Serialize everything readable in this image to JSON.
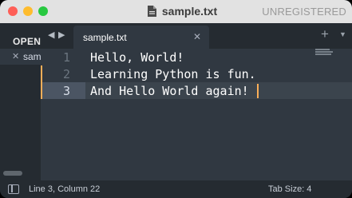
{
  "window": {
    "title": "sample.txt",
    "license_status": "UNREGISTERED"
  },
  "sidebar": {
    "header": "OPEN FILES",
    "files": [
      {
        "close_glyph": "✕",
        "label": "sample.txt"
      }
    ]
  },
  "tabbar": {
    "nav_back": "◀",
    "nav_forward": "▶",
    "tabs": [
      {
        "label": "sample.txt",
        "close_glyph": "✕"
      }
    ],
    "add_glyph": "+",
    "menu_glyph": "▼"
  },
  "editor": {
    "lines": [
      {
        "number": "1",
        "text": "Hello, World!"
      },
      {
        "number": "2",
        "text": "Learning Python is fun."
      },
      {
        "number": "3",
        "text": "And Hello World again!"
      }
    ],
    "active_line": 3
  },
  "statusbar": {
    "position": "Line 3, Column 22",
    "tab_size": "Tab Size: 4"
  },
  "colors": {
    "background": "#303841",
    "sidebar": "#252b31",
    "accent_caret": "#f9ae58",
    "close": "#fe5f57",
    "minimize": "#febc2e",
    "maximize": "#28c840"
  },
  "icons": [
    "close-window-icon",
    "minimize-window-icon",
    "maximize-window-icon",
    "document-icon",
    "sidebar-toggle-icon"
  ]
}
